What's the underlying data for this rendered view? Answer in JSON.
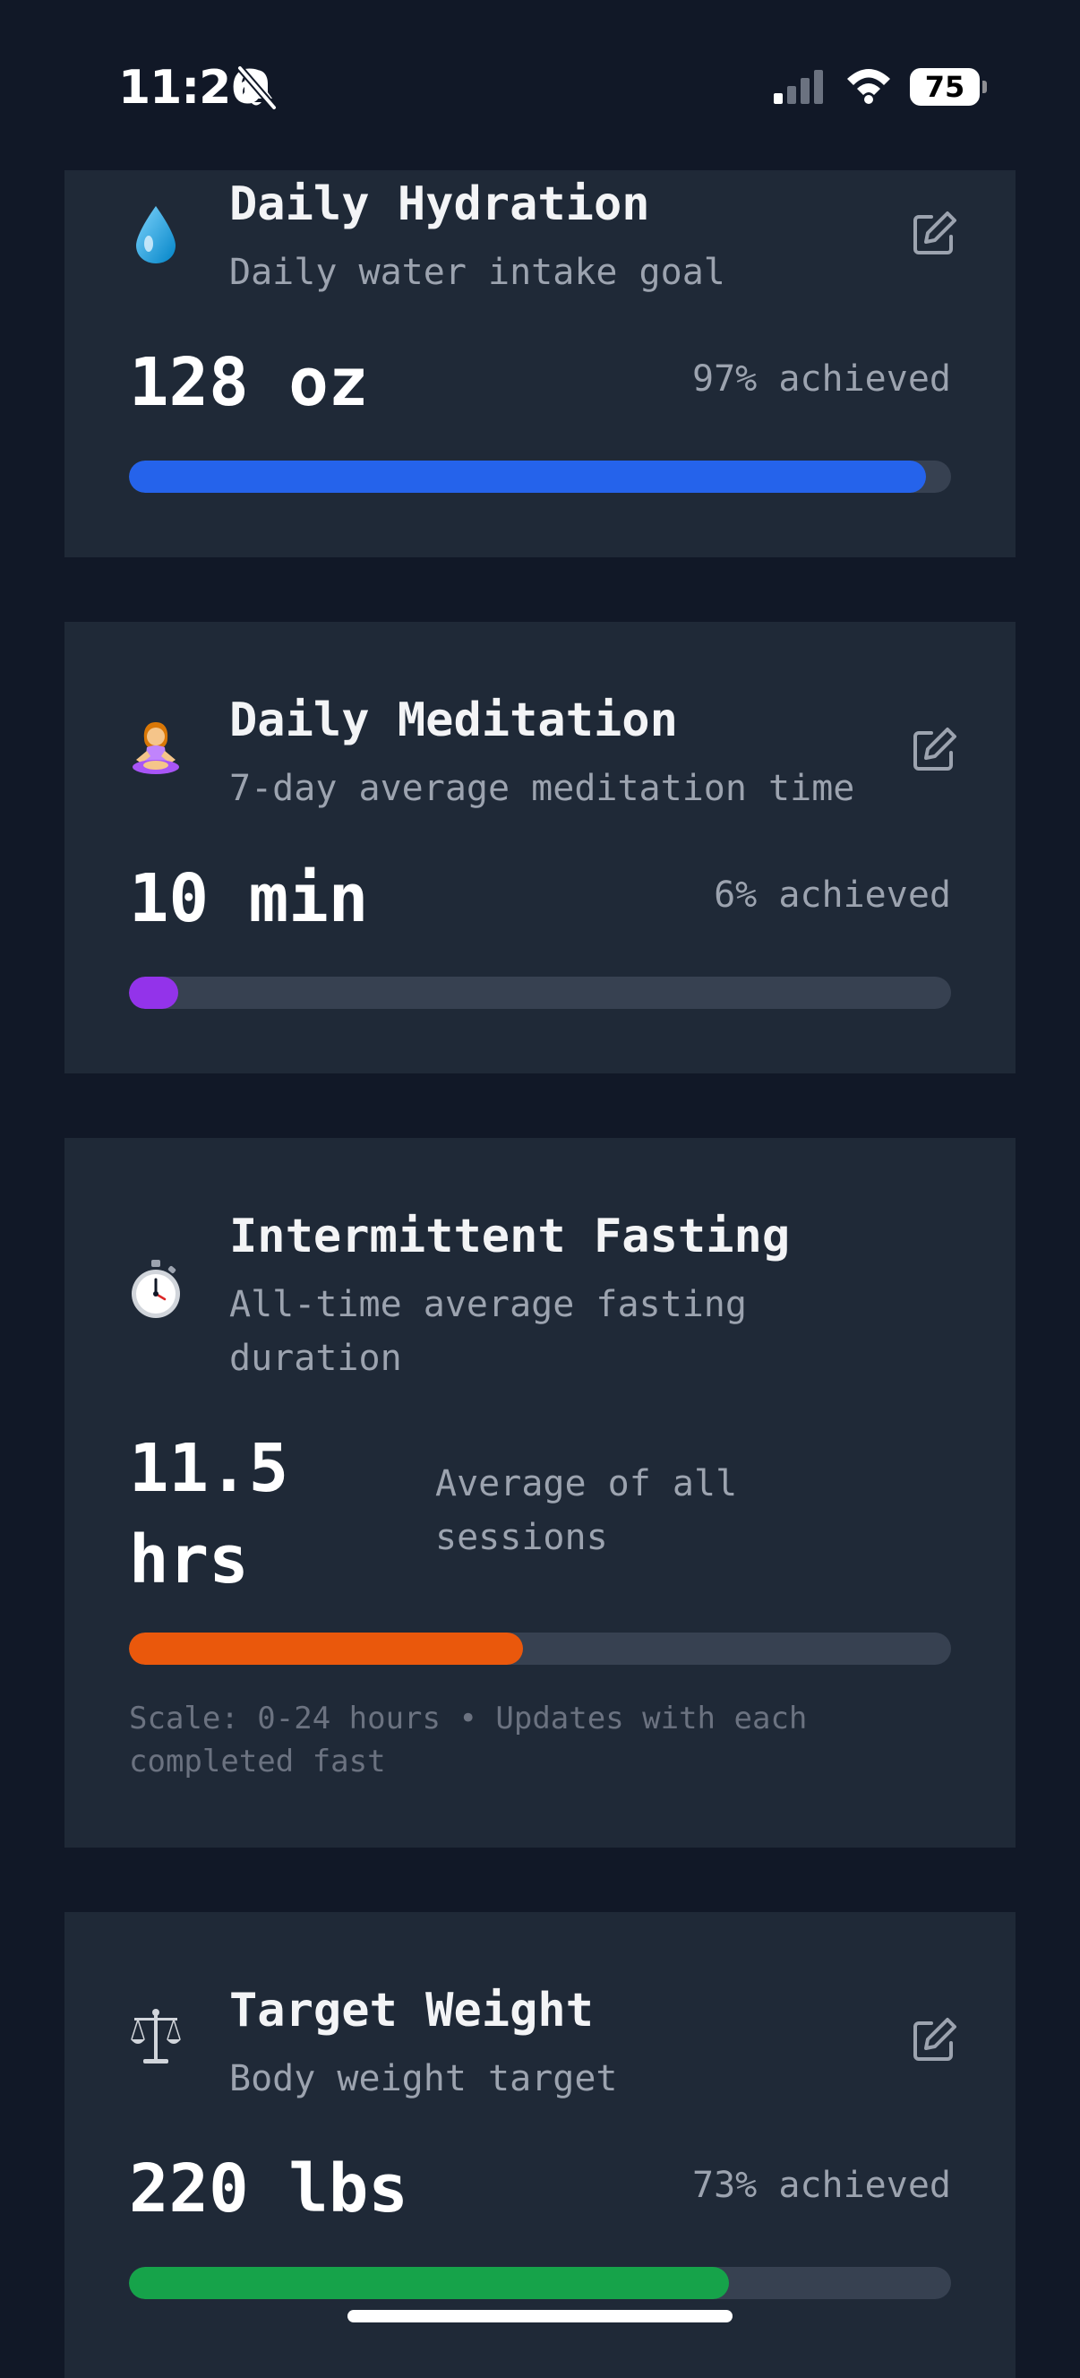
{
  "status_bar": {
    "time": "11:26",
    "battery": "75"
  },
  "goals": [
    {
      "icon": "water-drop-icon",
      "title": "Daily Hydration",
      "subtitle": "Daily water intake goal",
      "value": "128 oz",
      "progress_text": "97% achieved",
      "progress": 0.97,
      "color": "#2563eb"
    },
    {
      "icon": "meditation-icon",
      "title": "Daily Meditation",
      "subtitle": "7-day average meditation time",
      "value": "10 min",
      "progress_text": "6% achieved",
      "progress": 0.06,
      "color": "#9333ea"
    },
    {
      "icon": "stopwatch-icon",
      "title": "Intermittent Fasting",
      "subtitle": "All-time average fasting duration",
      "value": "11.5 hrs",
      "progress_text": "Average of all sessions",
      "progress": 0.479,
      "color": "#ea580c",
      "note": "Scale: 0-24 hours • Updates with each completed fast"
    },
    {
      "icon": "scale-icon",
      "title": "Target Weight",
      "subtitle": "Body weight target",
      "value": "220 lbs",
      "progress_text": "73% achieved",
      "progress": 0.73,
      "color": "#16a34a"
    }
  ]
}
